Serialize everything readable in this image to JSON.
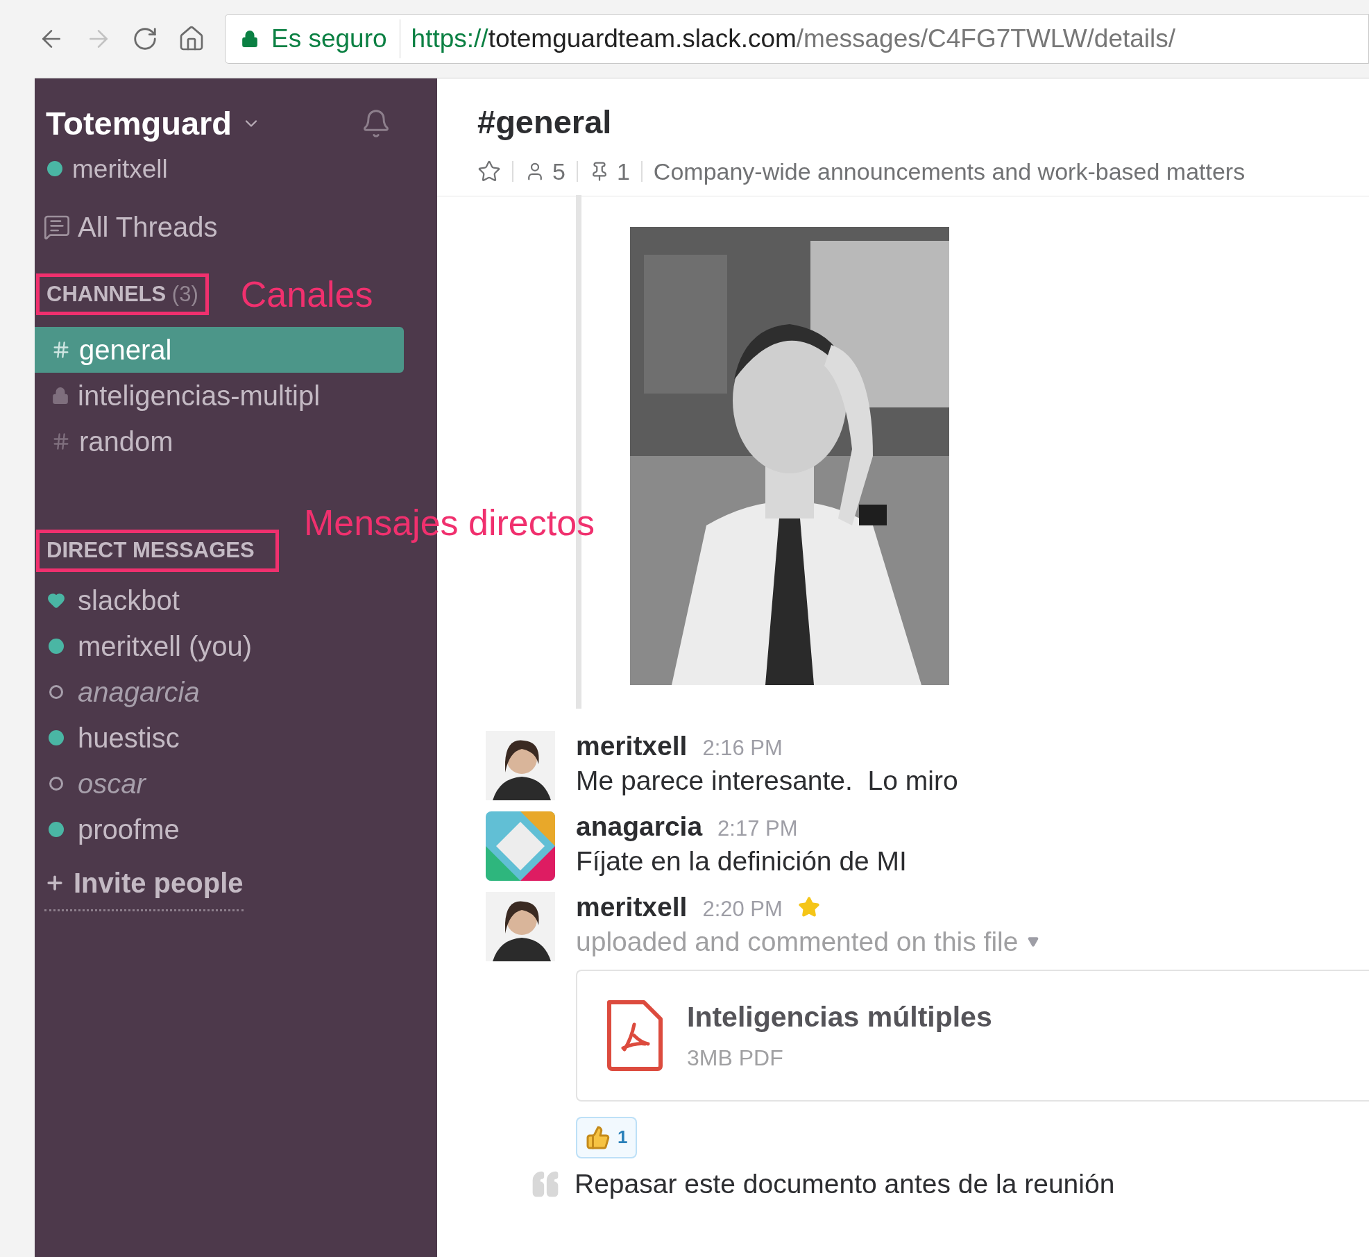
{
  "browser": {
    "secure_label": "Es seguro",
    "url_scheme": "https://",
    "url_host": "totemguardteam.slack.com",
    "url_path": "/messages/C4FG7TWLW/details/"
  },
  "sidebar": {
    "team": "Totemguard",
    "user": "meritxell",
    "all_threads": "All Threads",
    "channels_header": "CHANNELS",
    "channels_count": "(3)",
    "channels": [
      {
        "name": "general",
        "kind": "public",
        "selected": true
      },
      {
        "name": "inteligencias-multipl",
        "kind": "private",
        "selected": false
      },
      {
        "name": "random",
        "kind": "public",
        "selected": false
      }
    ],
    "dm_header": "DIRECT MESSAGES",
    "dms": [
      {
        "name": "slackbot",
        "kind": "bot"
      },
      {
        "name": "meritxell (you)",
        "kind": "active"
      },
      {
        "name": "anagarcia",
        "kind": "away"
      },
      {
        "name": "huestisc",
        "kind": "active"
      },
      {
        "name": "oscar",
        "kind": "away"
      },
      {
        "name": "proofme",
        "kind": "active"
      }
    ],
    "invite": "Invite people"
  },
  "annotations": [
    "Canales",
    "Mensajes directos"
  ],
  "channel": {
    "title": "#general",
    "members": "5",
    "pins": "1",
    "topic": "Company-wide announcements and work-based matters"
  },
  "messages": [
    {
      "author": "meritxell",
      "kind": "person",
      "time": "2:16 PM",
      "starred": false,
      "text": "Me parece interesante.  Lo miro"
    },
    {
      "author": "anagarcia",
      "kind": "logo",
      "time": "2:17 PM",
      "starred": false,
      "text": "Fíjate en la definición de MI"
    },
    {
      "author": "meritxell",
      "kind": "person",
      "time": "2:20 PM",
      "starred": true,
      "text": "uploaded and commented on this file",
      "file": {
        "name": "Inteligencias múltiples",
        "meta": "3MB PDF"
      },
      "reaction_count": "1",
      "comment": "Repasar este documento antes de la reunión"
    }
  ]
}
